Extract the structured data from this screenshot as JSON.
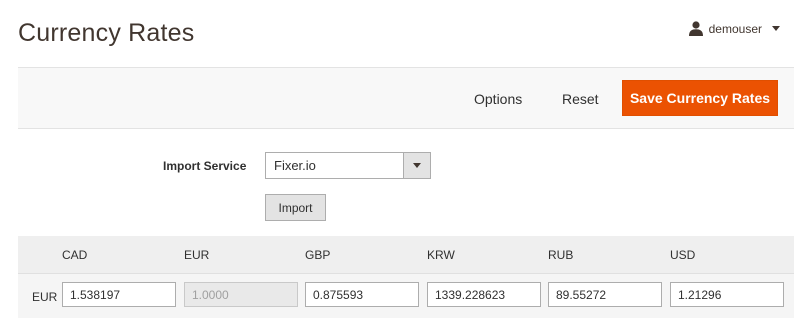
{
  "header": {
    "title": "Currency Rates",
    "user": {
      "name": "demouser",
      "icon": "user-icon"
    }
  },
  "toolbar": {
    "options_label": "Options",
    "reset_label": "Reset",
    "save_label": "Save Currency Rates",
    "accent_color": "#eb5202"
  },
  "import": {
    "label": "Import Service",
    "service_selected": "Fixer.io",
    "button_label": "Import"
  },
  "rates": {
    "row_label": "EUR",
    "columns": [
      {
        "code": "CAD",
        "value": "1.538197",
        "disabled": false
      },
      {
        "code": "EUR",
        "value": "1.0000",
        "disabled": true
      },
      {
        "code": "GBP",
        "value": "0.875593",
        "disabled": false
      },
      {
        "code": "KRW",
        "value": "1339.228623",
        "disabled": false
      },
      {
        "code": "RUB",
        "value": "89.55272",
        "disabled": false
      },
      {
        "code": "USD",
        "value": "1.21296",
        "disabled": false
      }
    ]
  }
}
